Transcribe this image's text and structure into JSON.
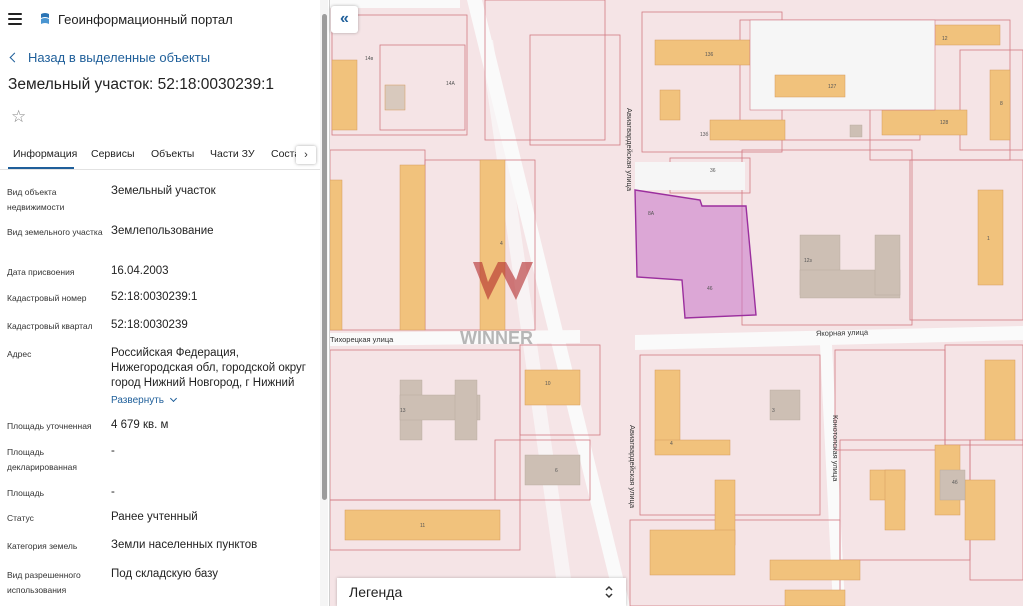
{
  "app": {
    "title": "Геоинформационный портал"
  },
  "nav": {
    "back_label": "Назад в выделенные объекты"
  },
  "parcel": {
    "title": "Земельный участок: 52:18:0030239:1"
  },
  "tabs": [
    {
      "label": "Информация",
      "active": true
    },
    {
      "label": "Сервисы",
      "active": false
    },
    {
      "label": "Объекты",
      "active": false
    },
    {
      "label": "Части ЗУ",
      "active": false
    },
    {
      "label": "Соста",
      "active": false
    }
  ],
  "info": {
    "object_type_label": "Вид объекта недвижимости",
    "object_type_value": "Земельный участок",
    "land_type_label": "Вид земельного участка",
    "land_type_value": "Землепользование",
    "assign_date_label": "Дата присвоения",
    "assign_date_value": "16.04.2003",
    "cadastral_number_label": "Кадастровый номер",
    "cadastral_number_value": "52:18:0030239:1",
    "cadastral_quarter_label": "Кадастровый квартал",
    "cadastral_quarter_value": "52:18:0030239",
    "address_label": "Адрес",
    "address_value": "Российская Федерация, Нижегородская обл, городской округ город Нижний Новгород, г Нижний",
    "expand_label": "Развернуть",
    "area_refined_label": "Площадь уточненная",
    "area_refined_value": "4 679 кв. м",
    "area_declared_label": "Площадь декларированная",
    "area_declared_value": "-",
    "area_label": "Площадь",
    "area_value": "-",
    "status_label": "Статус",
    "status_value": "Ранее учтенный",
    "category_label": "Категория земель",
    "category_value": "Земли населенных пунктов",
    "permitted_use_label": "Вид разрешенного использования",
    "permitted_use_value": "Под складскую базу"
  },
  "map": {
    "legend_label": "Легенда",
    "streets": {
      "tikhoretskaya": "Тихорецкая улица",
      "yakornaya": "Якорная улица",
      "aviagvardeiskaya_top": "Авиагвардейская улица",
      "aviagvardeiskaya_bottom": "Авиагвардейская улица",
      "konotopskaya": "Конотопская улица"
    },
    "watermark": "WINNER",
    "building_numbers": [
      "14в",
      "14А",
      "13",
      "13б",
      "12",
      "13а",
      "8",
      "8А",
      "36",
      "46",
      "12з",
      "4",
      "1",
      "10",
      "3",
      "13",
      "4",
      "6",
      "4б",
      "11"
    ],
    "colors": {
      "background": "#f5e4e6",
      "building": "#f1c27c",
      "selected_parcel": "#c774c9",
      "parcel_border": "#d27a84",
      "road": "#f9f9f9"
    }
  }
}
